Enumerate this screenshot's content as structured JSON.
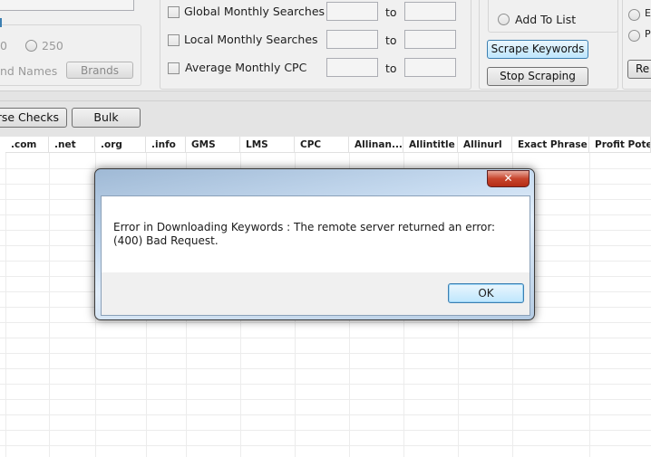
{
  "top_left": {
    "radio_a_label": "0",
    "radio_b_label": "250",
    "brand_names_label": "nd Names",
    "brands_button": "Brands"
  },
  "filters": {
    "global_label": "Global Monthly Searches",
    "local_label": "Local Monthly Searches",
    "cpc_label": "Average Monthly CPC",
    "to_label": "to"
  },
  "actions": {
    "add_to_list_label": "Add To List",
    "scrape_button": "Scrape Keywords",
    "stop_button": "Stop Scraping",
    "right_radio_1": "E",
    "right_radio_2": "P",
    "right_button": "Re"
  },
  "toolbar": {
    "reverse_checks_button": "rse Checks",
    "bulk_button": "Bulk"
  },
  "grid": {
    "columns": [
      ".com",
      ".net",
      ".org",
      ".info",
      "GMS",
      "LMS",
      "CPC",
      "Allinan...",
      "Allintitle",
      "Allinurl",
      "Exact Phrase",
      "Profit Poten"
    ]
  },
  "dialog": {
    "close_glyph": "✕",
    "message": "Error in Downloading Keywords : The remote server returned an error: (400) Bad Request.",
    "ok_button": "OK"
  }
}
